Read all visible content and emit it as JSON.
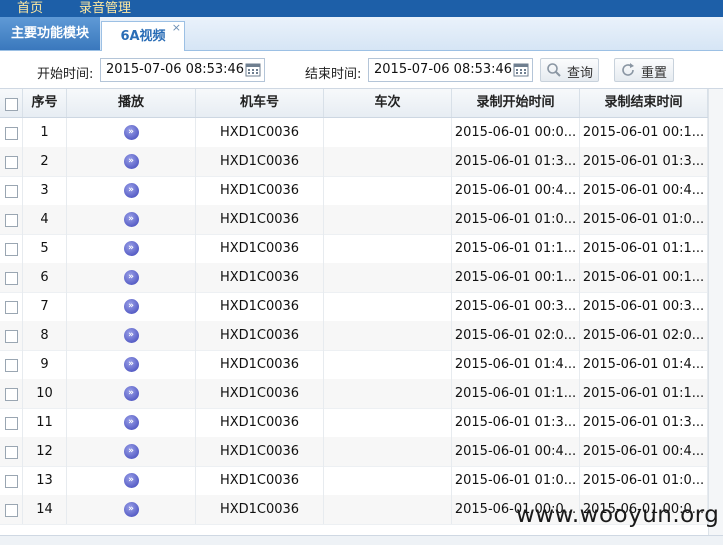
{
  "topnav": {
    "items": [
      "首页",
      "录音管理"
    ]
  },
  "tabs": {
    "main_label": "主要功能模块",
    "video_label": "6A视频",
    "close_glyph": "×"
  },
  "toolbar": {
    "start_label": "开始时间:",
    "start_value": "2015-07-06 08:53:46",
    "end_label": "结束时间:",
    "end_value": "2015-07-06 08:53:46",
    "query_label": "查询",
    "reset_label": "重置"
  },
  "grid": {
    "columns": [
      "序号",
      "播放",
      "机车号",
      "车次",
      "录制开始时间",
      "录制结束时间"
    ],
    "rows": [
      {
        "no": "1",
        "loco": "HXD1C0036",
        "train": "",
        "start": "2015-06-01 00:0...",
        "end": "2015-06-01 00:1..."
      },
      {
        "no": "2",
        "loco": "HXD1C0036",
        "train": "",
        "start": "2015-06-01 01:3...",
        "end": "2015-06-01 01:3..."
      },
      {
        "no": "3",
        "loco": "HXD1C0036",
        "train": "",
        "start": "2015-06-01 00:4...",
        "end": "2015-06-01 00:4..."
      },
      {
        "no": "4",
        "loco": "HXD1C0036",
        "train": "",
        "start": "2015-06-01 01:0...",
        "end": "2015-06-01 01:0..."
      },
      {
        "no": "5",
        "loco": "HXD1C0036",
        "train": "",
        "start": "2015-06-01 01:1...",
        "end": "2015-06-01 01:1..."
      },
      {
        "no": "6",
        "loco": "HXD1C0036",
        "train": "",
        "start": "2015-06-01 00:1...",
        "end": "2015-06-01 00:1..."
      },
      {
        "no": "7",
        "loco": "HXD1C0036",
        "train": "",
        "start": "2015-06-01 00:3...",
        "end": "2015-06-01 00:3..."
      },
      {
        "no": "8",
        "loco": "HXD1C0036",
        "train": "",
        "start": "2015-06-01 02:0...",
        "end": "2015-06-01 02:0..."
      },
      {
        "no": "9",
        "loco": "HXD1C0036",
        "train": "",
        "start": "2015-06-01 01:4...",
        "end": "2015-06-01 01:4..."
      },
      {
        "no": "10",
        "loco": "HXD1C0036",
        "train": "",
        "start": "2015-06-01 01:1...",
        "end": "2015-06-01 01:1..."
      },
      {
        "no": "11",
        "loco": "HXD1C0036",
        "train": "",
        "start": "2015-06-01 01:3...",
        "end": "2015-06-01 01:3..."
      },
      {
        "no": "12",
        "loco": "HXD1C0036",
        "train": "",
        "start": "2015-06-01 00:4...",
        "end": "2015-06-01 00:4..."
      },
      {
        "no": "13",
        "loco": "HXD1C0036",
        "train": "",
        "start": "2015-06-01 01:0...",
        "end": "2015-06-01 01:0..."
      },
      {
        "no": "14",
        "loco": "HXD1C0036",
        "train": "",
        "start": "2015-06-01 00:0...",
        "end": "2015-06-01 00:0..."
      }
    ]
  },
  "watermark": "www.wooyun.org",
  "colors": {
    "nav_bg": "#1d5fa8",
    "tab_active": "#3a78bd",
    "play_icon": "#3d44b8"
  }
}
